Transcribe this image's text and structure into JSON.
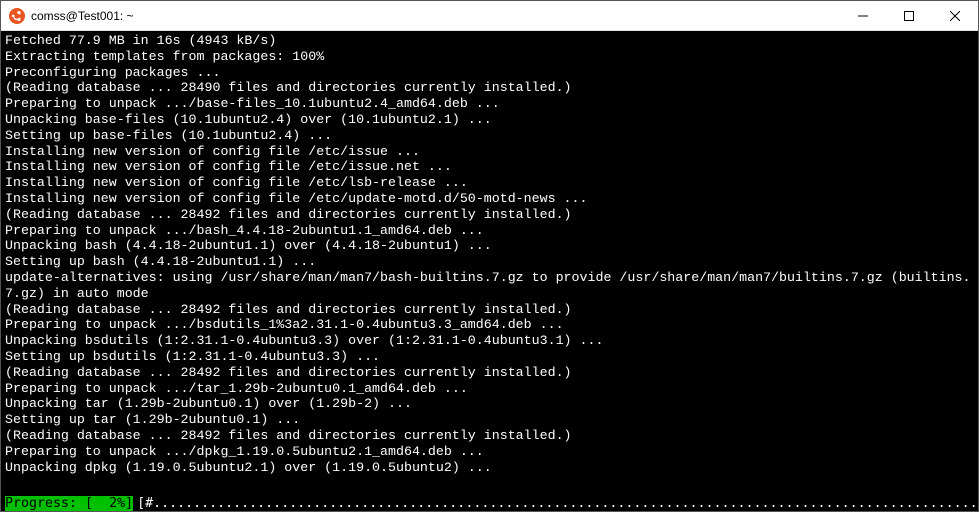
{
  "window": {
    "title": "comss@Test001: ~"
  },
  "terminal": {
    "lines": [
      "Fetched 77.9 MB in 16s (4943 kB/s)",
      "Extracting templates from packages: 100%",
      "Preconfiguring packages ...",
      "(Reading database ... 28490 files and directories currently installed.)",
      "Preparing to unpack .../base-files_10.1ubuntu2.4_amd64.deb ...",
      "Unpacking base-files (10.1ubuntu2.4) over (10.1ubuntu2.1) ...",
      "Setting up base-files (10.1ubuntu2.4) ...",
      "Installing new version of config file /etc/issue ...",
      "Installing new version of config file /etc/issue.net ...",
      "Installing new version of config file /etc/lsb-release ...",
      "Installing new version of config file /etc/update-motd.d/50-motd-news ...",
      "(Reading database ... 28492 files and directories currently installed.)",
      "Preparing to unpack .../bash_4.4.18-2ubuntu1.1_amd64.deb ...",
      "Unpacking bash (4.4.18-2ubuntu1.1) over (4.4.18-2ubuntu1) ...",
      "Setting up bash (4.4.18-2ubuntu1.1) ...",
      "update-alternatives: using /usr/share/man/man7/bash-builtins.7.gz to provide /usr/share/man/man7/builtins.7.gz (builtins.7.gz) in auto mode",
      "(Reading database ... 28492 files and directories currently installed.)",
      "Preparing to unpack .../bsdutils_1%3a2.31.1-0.4ubuntu3.3_amd64.deb ...",
      "Unpacking bsdutils (1:2.31.1-0.4ubuntu3.3) over (1:2.31.1-0.4ubuntu3.1) ...",
      "Setting up bsdutils (1:2.31.1-0.4ubuntu3.3) ...",
      "(Reading database ... 28492 files and directories currently installed.)",
      "Preparing to unpack .../tar_1.29b-2ubuntu0.1_amd64.deb ...",
      "Unpacking tar (1.29b-2ubuntu0.1) over (1.29b-2) ...",
      "Setting up tar (1.29b-2ubuntu0.1) ...",
      "(Reading database ... 28492 files and directories currently installed.)",
      "Preparing to unpack .../dpkg_1.19.0.5ubuntu2.1_amd64.deb ...",
      "Unpacking dpkg (1.19.0.5ubuntu2.1) over (1.19.0.5ubuntu2) ..."
    ],
    "progress": {
      "label": "Progress: [  2%]",
      "bar": "[#.........................................................................................................................]"
    }
  }
}
